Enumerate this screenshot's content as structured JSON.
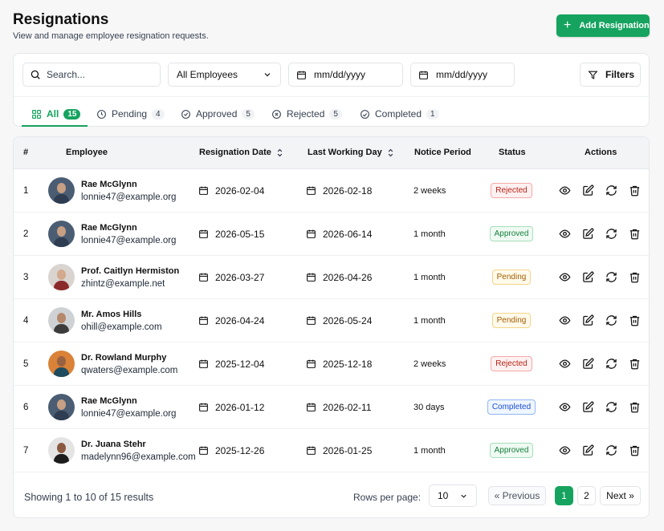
{
  "header": {
    "title": "Resignations",
    "subtitle": "View and manage employee resignation requests.",
    "add_label": "Add Resignation"
  },
  "filters": {
    "search_placeholder": "Search...",
    "employee_select": "All Employees",
    "date_from": "mm/dd/yyyy",
    "date_to": "mm/dd/yyyy",
    "filters_label": "Filters"
  },
  "tabs": [
    {
      "label": "All",
      "count": "15",
      "icon": "grid-icon"
    },
    {
      "label": "Pending",
      "count": "4",
      "icon": "clock-icon"
    },
    {
      "label": "Approved",
      "count": "5",
      "icon": "check-circle-icon"
    },
    {
      "label": "Rejected",
      "count": "5",
      "icon": "x-circle-icon"
    },
    {
      "label": "Completed",
      "count": "1",
      "icon": "smile-icon"
    }
  ],
  "table": {
    "headers": {
      "num": "#",
      "employee": "Employee",
      "resignation_date": "Resignation Date",
      "last_day": "Last Working Day",
      "notice": "Notice Period",
      "status": "Status",
      "actions": "Actions"
    },
    "rows": [
      {
        "num": "1",
        "name": "Rae McGlynn",
        "email": "lonnie47@example.org",
        "rdate": "2026-02-04",
        "ldate": "2026-02-18",
        "notice": "2 weeks",
        "status": "Rejected"
      },
      {
        "num": "2",
        "name": "Rae McGlynn",
        "email": "lonnie47@example.org",
        "rdate": "2026-05-15",
        "ldate": "2026-06-14",
        "notice": "1 month",
        "status": "Approved"
      },
      {
        "num": "3",
        "name": "Prof. Caitlyn Hermiston",
        "email": "zhintz@example.net",
        "rdate": "2026-03-27",
        "ldate": "2026-04-26",
        "notice": "1 month",
        "status": "Pending"
      },
      {
        "num": "4",
        "name": "Mr. Amos Hills",
        "email": "ohill@example.com",
        "rdate": "2026-04-24",
        "ldate": "2026-05-24",
        "notice": "1 month",
        "status": "Pending"
      },
      {
        "num": "5",
        "name": "Dr. Rowland Murphy",
        "email": "qwaters@example.com",
        "rdate": "2025-12-04",
        "ldate": "2025-12-18",
        "notice": "2 weeks",
        "status": "Rejected"
      },
      {
        "num": "6",
        "name": "Rae McGlynn",
        "email": "lonnie47@example.org",
        "rdate": "2026-01-12",
        "ldate": "2026-02-11",
        "notice": "30 days",
        "status": "Completed"
      },
      {
        "num": "7",
        "name": "Dr. Juana Stehr",
        "email": "madelynn96@example.com",
        "rdate": "2025-12-26",
        "ldate": "2026-01-25",
        "notice": "1 month",
        "status": "Approved"
      }
    ]
  },
  "footer": {
    "showing": "Showing 1 to 10 of 15 results",
    "rows_per_page_label": "Rows per page:",
    "rows_per_page": "10",
    "prev_label": "« Previous",
    "page1": "1",
    "page2": "2",
    "next_label": "Next »"
  },
  "colors": {
    "accent": "#16a35f",
    "rejected": "#b42318",
    "approved": "#16803c",
    "pending": "#a15c00",
    "completed": "#1d4ed8"
  }
}
